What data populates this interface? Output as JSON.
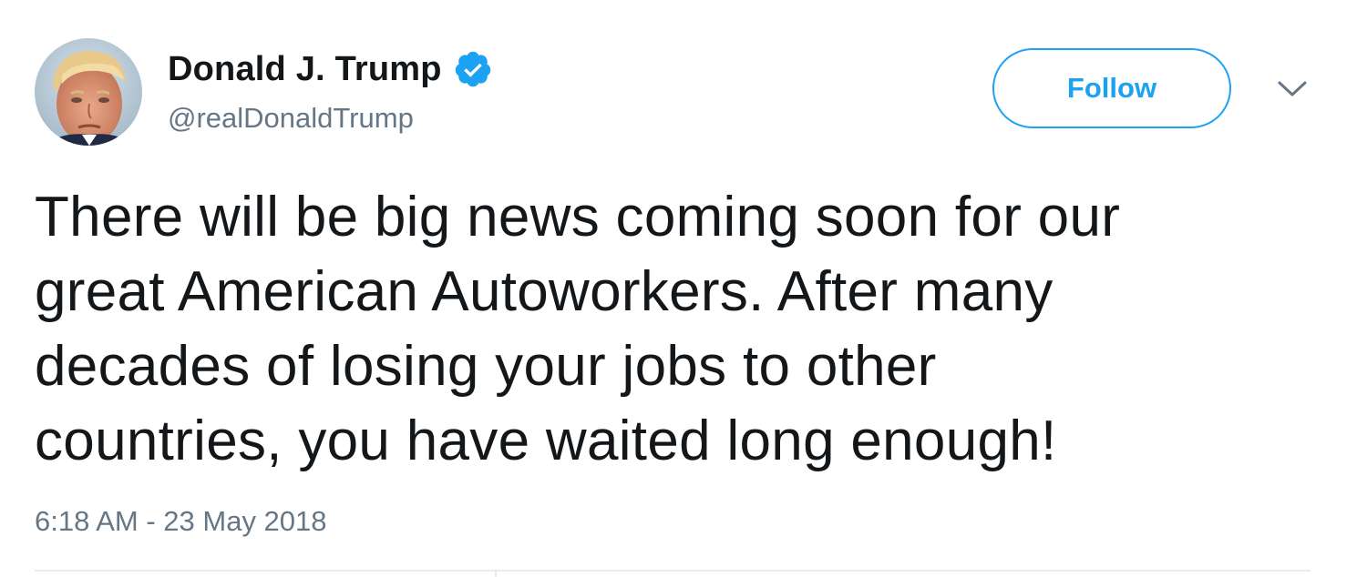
{
  "author": {
    "display_name": "Donald J. Trump",
    "handle": "@realDonaldTrump",
    "verified": true,
    "avatar_icon": "profile-photo"
  },
  "actions": {
    "follow_label": "Follow",
    "more_icon": "chevron-down-icon"
  },
  "tweet": {
    "text_lines": [
      "There will be big news coming soon for our",
      "great American Autoworkers. After many",
      "decades of losing your jobs to other",
      "countries, you have waited long enough!"
    ],
    "timestamp": "6:18 AM - 23 May 2018"
  },
  "colors": {
    "accent": "#1da1f2",
    "text": "#14171a",
    "secondary_text": "#657786",
    "divider": "#e6ecf0"
  }
}
